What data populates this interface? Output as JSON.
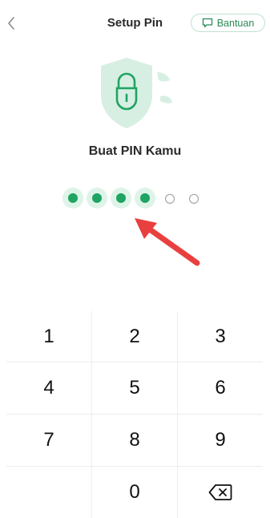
{
  "header": {
    "title": "Setup Pin",
    "help_label": "Bantuan"
  },
  "main": {
    "heading": "Buat PIN Kamu"
  },
  "pin": {
    "length": 6,
    "entered": 4
  },
  "keypad": {
    "keys": [
      "1",
      "2",
      "3",
      "4",
      "5",
      "6",
      "7",
      "8",
      "9",
      "",
      "0",
      "⌫"
    ]
  },
  "colors": {
    "accent": "#1fa463",
    "accent_light": "#dff4e8",
    "shield": "#d7efe2",
    "arrow": "#e8403f"
  },
  "icons": {
    "back": "chevron-left-icon",
    "help": "chat-bubble-icon",
    "hero": "shield-lock-icon",
    "delete": "backspace-icon"
  }
}
